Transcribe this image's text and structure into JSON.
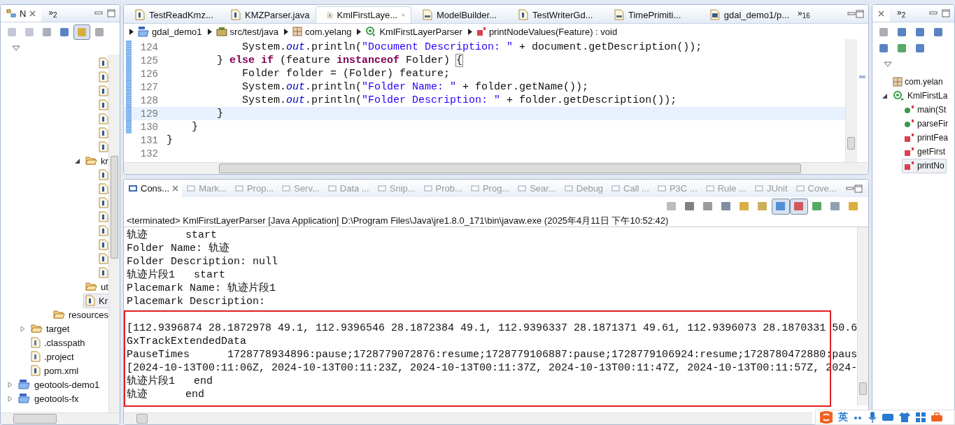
{
  "navigator": {
    "tab_label": "N",
    "overflow": "»$_{2}$",
    "toolbar": [
      {
        "kind": "back",
        "pressed": false
      },
      {
        "kind": "forward",
        "pressed": false
      },
      {
        "kind": "home",
        "pressed": false
      },
      {
        "kind": "collapse",
        "pressed": false
      },
      {
        "kind": "link",
        "pressed": true
      },
      {
        "kind": "filter",
        "pressed": false
      }
    ],
    "tree": [
      {
        "kind": "offscreen",
        "children": [
          {
            "kind": "offscreen",
            "children": [
              {
                "kind": "offscreen",
                "children": [
                  {
                    "kind": "offscreen",
                    "children": [
                      {
                        "kind": "java"
                      },
                      {
                        "kind": "java"
                      },
                      {
                        "kind": "java"
                      },
                      {
                        "kind": "java"
                      },
                      {
                        "kind": "java"
                      },
                      {
                        "kind": "java"
                      },
                      {
                        "kind": "java"
                      }
                    ]
                  },
                  {
                    "kind": "package",
                    "label": "kr",
                    "expanded": true,
                    "children": [
                      {
                        "kind": "java"
                      },
                      {
                        "kind": "java"
                      },
                      {
                        "kind": "java"
                      },
                      {
                        "kind": "java"
                      },
                      {
                        "kind": "java"
                      },
                      {
                        "kind": "java"
                      },
                      {
                        "kind": "java"
                      },
                      {
                        "kind": "java"
                      }
                    ]
                  },
                  {
                    "kind": "package",
                    "label": "ut"
                  },
                  {
                    "kind": "java",
                    "label": "Kr",
                    "selected": true
                  }
                ]
              },
              {
                "kind": "folder",
                "label": "resources"
              }
            ]
          },
          {
            "kind": "folder",
            "label": "target",
            "expanded": false
          },
          {
            "kind": "xml",
            "label": ".classpath"
          },
          {
            "kind": "xml",
            "label": ".project"
          },
          {
            "kind": "maven",
            "label": "pom.xml"
          }
        ]
      },
      {
        "kind": "project",
        "label": "geotools-demo1",
        "expanded": false
      },
      {
        "kind": "project",
        "label": "geotools-fx",
        "expanded": false
      }
    ]
  },
  "editor": {
    "overflow": "»$_{16}$",
    "tabs": [
      {
        "label": "TestReadKmz...",
        "kind": "java",
        "selected": false
      },
      {
        "label": "KMZParser.java",
        "kind": "java",
        "selected": false
      },
      {
        "label": "KmlFirstLaye...",
        "kind": "java",
        "selected": true
      },
      {
        "label": "ModelBuilder...",
        "kind": "class",
        "selected": false
      },
      {
        "label": "TestWriterGd...",
        "kind": "java",
        "selected": false
      },
      {
        "label": "TimePrimiti...",
        "kind": "class",
        "selected": false
      },
      {
        "label": "gdal_demo1/p...",
        "kind": "maven",
        "selected": false
      }
    ],
    "breadcrumb": [
      {
        "kind": "project",
        "label": "gdal_demo1"
      },
      {
        "kind": "source",
        "label": "src/test/java"
      },
      {
        "kind": "package",
        "label": "com.yelang"
      },
      {
        "kind": "class",
        "label": "KmlFirstLayerParser"
      },
      {
        "kind": "method",
        "label": "printNodeValues(Feature) : void"
      }
    ],
    "lines": [
      {
        "number": "124",
        "changed": true,
        "current": false,
        "tokens": [
          {
            "kind": "plain",
            "s": "            System."
          },
          {
            "kind": "field",
            "s": "out"
          },
          {
            "kind": "plain",
            "s": ".println("
          },
          {
            "kind": "string",
            "s": "\"Document Description: \""
          },
          {
            "kind": "plain",
            "s": " + document.getDescription());"
          }
        ]
      },
      {
        "number": "125",
        "changed": true,
        "current": false,
        "tokens": [
          {
            "kind": "plain",
            "s": "        } "
          },
          {
            "kind": "keyword",
            "s": "else if"
          },
          {
            "kind": "plain",
            "s": " (feature "
          },
          {
            "kind": "keyword",
            "s": "instanceof"
          },
          {
            "kind": "plain",
            "s": " Folder) "
          },
          {
            "kind": "bracket",
            "s": "{"
          }
        ]
      },
      {
        "number": "126",
        "changed": true,
        "current": false,
        "tokens": [
          {
            "kind": "plain",
            "s": "            Folder folder = (Folder) feature;"
          }
        ]
      },
      {
        "number": "127",
        "changed": true,
        "current": false,
        "tokens": [
          {
            "kind": "plain",
            "s": "            System."
          },
          {
            "kind": "field",
            "s": "out"
          },
          {
            "kind": "plain",
            "s": ".println("
          },
          {
            "kind": "string",
            "s": "\"Folder Name: \""
          },
          {
            "kind": "plain",
            "s": " + folder.getName());"
          }
        ]
      },
      {
        "number": "128",
        "changed": true,
        "current": false,
        "tokens": [
          {
            "kind": "plain",
            "s": "            System."
          },
          {
            "kind": "field",
            "s": "out"
          },
          {
            "kind": "plain",
            "s": ".println("
          },
          {
            "kind": "string",
            "s": "\"Folder Description: \""
          },
          {
            "kind": "plain",
            "s": " + folder.getDescription());"
          }
        ]
      },
      {
        "number": "129",
        "changed": true,
        "current": true,
        "tokens": [
          {
            "kind": "plain",
            "s": "        }"
          }
        ]
      },
      {
        "number": "130",
        "changed": true,
        "current": false,
        "tokens": [
          {
            "kind": "plain",
            "s": "    }"
          }
        ]
      },
      {
        "number": "131",
        "changed": false,
        "current": false,
        "tokens": [
          {
            "kind": "plain",
            "s": "}"
          }
        ]
      },
      {
        "number": "132",
        "changed": false,
        "current": false
      }
    ]
  },
  "outline": {
    "overflow": "»$_{2}$",
    "toolbar": [
      {
        "kind": "fields",
        "pressed": false
      },
      {
        "kind": "collapse",
        "pressed": false
      },
      {
        "kind": "sort",
        "pressed": false
      },
      {
        "kind": "hide",
        "pressed": false
      },
      {
        "kind": "hide-static",
        "pressed": false
      },
      {
        "kind": "dot",
        "pressed": false
      },
      {
        "kind": "hide-local",
        "pressed": false
      }
    ],
    "items": [
      {
        "kind": "package",
        "label": "com.yelan"
      },
      {
        "kind": "class",
        "label": "KmlFirstLa",
        "expanded": true,
        "children": [
          {
            "kind": "public",
            "label": "main(St",
            "selected": false
          },
          {
            "kind": "public",
            "label": "parseFir",
            "selected": false
          },
          {
            "kind": "private",
            "label": "printFea",
            "selected": false
          },
          {
            "kind": "private",
            "label": "getFirst",
            "selected": false
          },
          {
            "kind": "private",
            "label": "printNo",
            "selected": true
          }
        ]
      }
    ]
  },
  "console": {
    "tabs": [
      {
        "label": "Cons...",
        "selected": true
      },
      {
        "label": "Mark...",
        "selected": false
      },
      {
        "label": "Prop...",
        "selected": false
      },
      {
        "label": "Serv...",
        "selected": false
      },
      {
        "label": "Data ...",
        "selected": false
      },
      {
        "label": "Snip...",
        "selected": false
      },
      {
        "label": "Prob...",
        "selected": false
      },
      {
        "label": "Prog...",
        "selected": false
      },
      {
        "label": "Sear...",
        "selected": false
      },
      {
        "label": "Debug",
        "selected": false
      },
      {
        "label": "Call ...",
        "selected": false
      },
      {
        "label": "P3C ...",
        "selected": false
      },
      {
        "label": "Rule ...",
        "selected": false
      },
      {
        "label": "JUnit",
        "selected": false
      },
      {
        "label": "Cove...",
        "selected": false
      }
    ],
    "toolbar": [
      {
        "kind": "stop",
        "pressed": false
      },
      {
        "kind": "remove",
        "pressed": false
      },
      {
        "kind": "remove-all",
        "pressed": false
      },
      {
        "kind": "clear",
        "pressed": false
      },
      {
        "kind": "lock",
        "pressed": false
      },
      {
        "kind": "wrap",
        "pressed": false
      },
      {
        "kind": "stdout",
        "pressed": true
      },
      {
        "kind": "stderr",
        "pressed": true
      },
      {
        "kind": "pin",
        "pressed": false
      },
      {
        "kind": "display",
        "pressed": false
      },
      {
        "kind": "new",
        "pressed": false
      }
    ],
    "header": "<terminated> KmlFirstLayerParser [Java Application] D:\\Program Files\\Java\\jre1.8.0_171\\bin\\javaw.exe (2025年4月11日 下午10:52:42)",
    "lines": [
      "轨迹      start",
      "Folder Name: 轨迹",
      "Folder Description: null",
      "轨迹片段1   start",
      "Placemark Name: 轨迹片段1",
      "Placemark Description:"
    ],
    "highlighted_lines": [
      "[112.9396874 28.1872978 49.1, 112.9396546 28.1872384 49.1, 112.9396337 28.1871371 49.61, 112.9396073 28.1870331 50.6",
      "GxTrackExtendedData",
      "PauseTimes      1728778934896:pause;1728779072876:resume;1728779106887:pause;1728779106924:resume;1728780472880:paus",
      "[2024-10-13T00:11:06Z, 2024-10-13T00:11:23Z, 2024-10-13T00:11:37Z, 2024-10-13T00:11:47Z, 2024-10-13T00:11:57Z, 2024-",
      "轨迹片段1   end",
      "轨迹      end"
    ]
  },
  "ime_bar": {
    "mode": "英"
  }
}
